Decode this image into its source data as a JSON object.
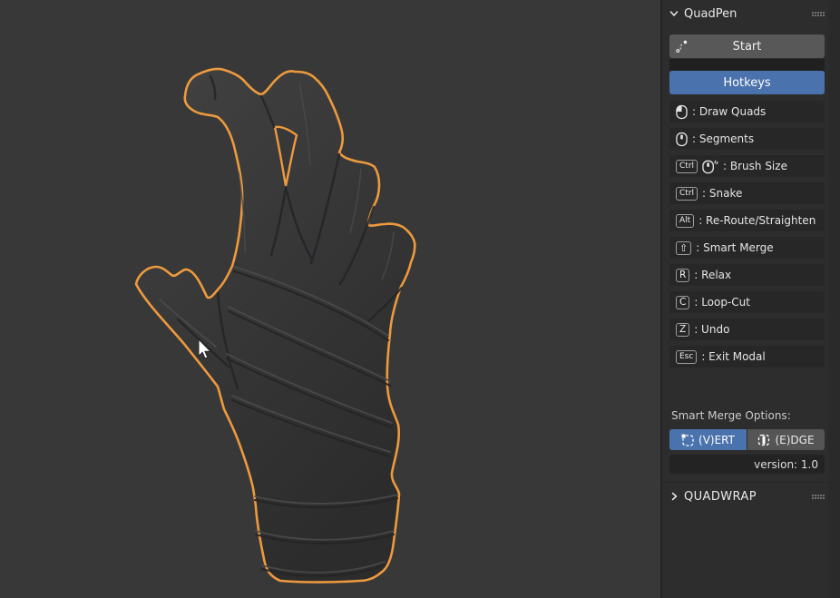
{
  "viewport": {
    "background_color": "#383838",
    "object": "sculpted-hand-with-crossed-fingers-and-wrapped-wrist",
    "selection_outline_color": "#ed9a3e",
    "cursor": "arrow"
  },
  "sidebar": {
    "quadpen_panel": {
      "title": "QuadPen",
      "expanded": true
    },
    "start_button": {
      "label": "Start",
      "icon": "draw-curve-icon"
    },
    "hotkeys_header": {
      "label": "Hotkeys",
      "color": "#4a72ac"
    },
    "hotkeys": [
      {
        "keys": [
          {
            "type": "mouse",
            "icon": "mouse-left-icon"
          }
        ],
        "label": ": Draw Quads"
      },
      {
        "keys": [
          {
            "type": "mouse",
            "icon": "mouse-middle-icon"
          }
        ],
        "label": ": Segments"
      },
      {
        "keys": [
          {
            "type": "kbd",
            "text": "Ctrl"
          },
          {
            "type": "mouse",
            "icon": "mouse-scroll-icon"
          }
        ],
        "label": ": Brush Size"
      },
      {
        "keys": [
          {
            "type": "kbd",
            "text": "Ctrl"
          }
        ],
        "label": ": Snake"
      },
      {
        "keys": [
          {
            "type": "kbd",
            "text": "Alt"
          }
        ],
        "label": ": Re-Route/Straighten"
      },
      {
        "keys": [
          {
            "type": "kbd",
            "text": "⇧"
          }
        ],
        "label": ": Smart Merge"
      },
      {
        "keys": [
          {
            "type": "kbd",
            "text": "R"
          }
        ],
        "label": ": Relax"
      },
      {
        "keys": [
          {
            "type": "kbd",
            "text": "C"
          }
        ],
        "label": ": Loop-Cut"
      },
      {
        "keys": [
          {
            "type": "kbd",
            "text": "Z"
          }
        ],
        "label": ": Undo"
      },
      {
        "keys": [
          {
            "type": "kbd",
            "text": "Esc"
          }
        ],
        "label": ": Exit Modal"
      }
    ],
    "smart_merge": {
      "label": "Smart Merge Options:",
      "options": [
        {
          "label": "(V)ERT",
          "selected": true,
          "icon": "vertex-select-icon",
          "color": "#4a72ac"
        },
        {
          "label": "(E)DGE",
          "selected": false,
          "icon": "edge-select-icon",
          "color": "#555555"
        }
      ]
    },
    "version_field": {
      "label": "version: 1.0"
    },
    "quadwrap_panel": {
      "title": "QUADWRAP",
      "expanded": false
    }
  }
}
